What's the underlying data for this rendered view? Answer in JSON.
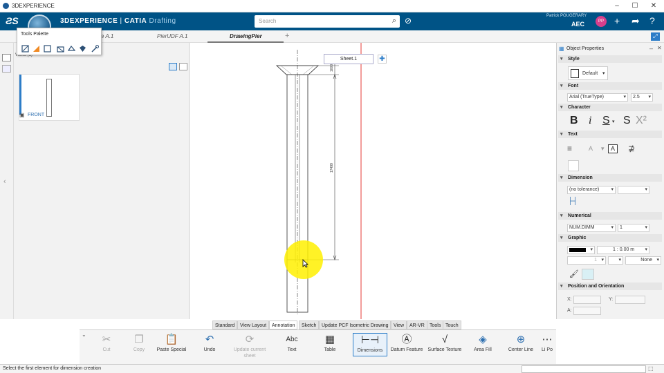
{
  "window": {
    "title": "3DEXPERIENCE"
  },
  "appbar": {
    "brand_main": "3DEXPERIENCE",
    "brand_app": "CATIA",
    "brand_sub": "Drafting",
    "search_placeholder": "Search",
    "user_name": "Patrick POUGERARY",
    "role": "AEC",
    "avatar_initials": "PP"
  },
  "tabs": [
    {
      "label": "e A.1"
    },
    {
      "label": "PierUDF A.1"
    },
    {
      "label": "DrawingPier"
    }
  ],
  "palette": {
    "title": "Tools Palette"
  },
  "views_panel": {
    "label": "Views (1)",
    "view_label": "FRONT"
  },
  "canvas": {
    "sheet_label": "Sheet.1",
    "dim_top": "1000",
    "dim_length": "17499"
  },
  "properties": {
    "title": "Object Properties",
    "sections": {
      "style": "Style",
      "font": "Font",
      "character": "Character",
      "text": "Text",
      "dimension": "Dimension",
      "numerical": "Numerical",
      "graphic": "Graphic",
      "position": "Position and Orientation"
    },
    "style_value": "Default",
    "font_name": "Arial (TrueType)",
    "font_size": "2.5",
    "tolerance": "(no tolerance)",
    "numerical_format": "NUM.DIMM",
    "numerical_value": "1",
    "line_weight": "1 : 0.00 m",
    "line_none": "None",
    "line_small": "1",
    "pos_x_label": "X:",
    "pos_y_label": "Y:",
    "pos_a_label": "A:"
  },
  "command_tabs": [
    "Standard",
    "View Layout",
    "Annotation",
    "Sketch",
    "Update PCF Isometric Drawing",
    "View",
    "AR-VR",
    "Tools",
    "Touch"
  ],
  "actions": [
    {
      "label": "Cut"
    },
    {
      "label": "Copy"
    },
    {
      "label": "Paste Special"
    },
    {
      "label": "Undo"
    },
    {
      "label": "Update current sheet"
    },
    {
      "label": "Text",
      "icon_text": "Abc"
    },
    {
      "label": "Table"
    },
    {
      "label": "Dimensions"
    },
    {
      "label": "Datum Feature"
    },
    {
      "label": "Surface Texture"
    },
    {
      "label": "Area Fill"
    },
    {
      "label": "Center Line"
    },
    {
      "label": "Li Po"
    }
  ],
  "status": {
    "text": "Select the first element for dimension creation"
  },
  "colors": {
    "brand_blue": "#005386",
    "accent": "#2d7dc8",
    "highlight": "#fff000"
  }
}
